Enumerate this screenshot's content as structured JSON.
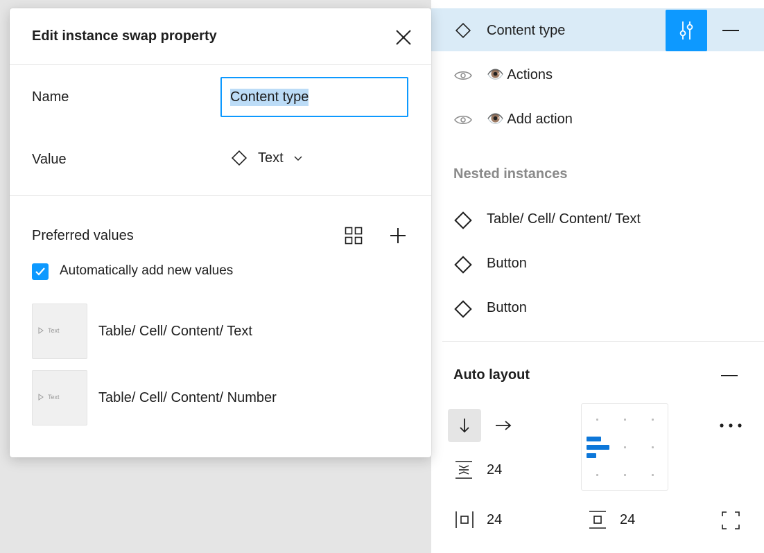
{
  "modal": {
    "title": "Edit instance swap property",
    "name_label": "Name",
    "name_value": "Content type",
    "value_label": "Value",
    "value_selected": "Text",
    "preferred_label": "Preferred values",
    "auto_add_label": "Automatically add new values",
    "auto_add_checked": true,
    "preferred_items": [
      {
        "thumb_text": "Text",
        "label": "Table/ Cell/ Content/ Text"
      },
      {
        "thumb_text": "Text",
        "label": "Table/ Cell/ Content/ Number"
      }
    ]
  },
  "panel": {
    "properties": [
      {
        "label": "Content type",
        "icon": "component-diamond-icon",
        "active": true
      },
      {
        "emoji": "👁️",
        "label": "Actions",
        "icon": "eye-icon"
      },
      {
        "emoji": "👁️",
        "label": "Add action",
        "icon": "eye-icon"
      }
    ],
    "nested_title": "Nested instances",
    "nested_items": [
      {
        "label": "Table/ Cell/ Content/ Text"
      },
      {
        "label": "Button"
      },
      {
        "label": "Button"
      }
    ],
    "auto_layout": {
      "title": "Auto layout",
      "spacing": "24",
      "padding_horizontal": "24",
      "padding_vertical": "24"
    }
  },
  "colors": {
    "accent": "#0d99ff",
    "active_row": "#daebf7",
    "align_bar": "#0d77d9"
  }
}
